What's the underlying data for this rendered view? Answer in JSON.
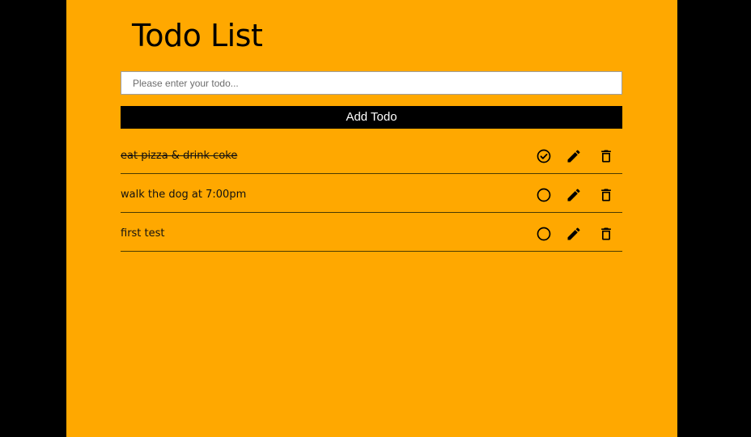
{
  "app": {
    "title": "Todo List",
    "background_color": "#FFA800"
  },
  "form": {
    "input_value": "",
    "input_placeholder": "Please enter your todo...",
    "add_button_label": "Add Todo"
  },
  "todos": [
    {
      "text": "eat pizza & drink coke",
      "completed": true
    },
    {
      "text": "walk the dog at 7:00pm",
      "completed": false
    },
    {
      "text": "first test",
      "completed": false
    }
  ],
  "icons": {
    "complete_done": "check-circle-icon",
    "complete_open": "circle-outline-icon",
    "edit": "pencil-icon",
    "delete": "trash-icon"
  }
}
